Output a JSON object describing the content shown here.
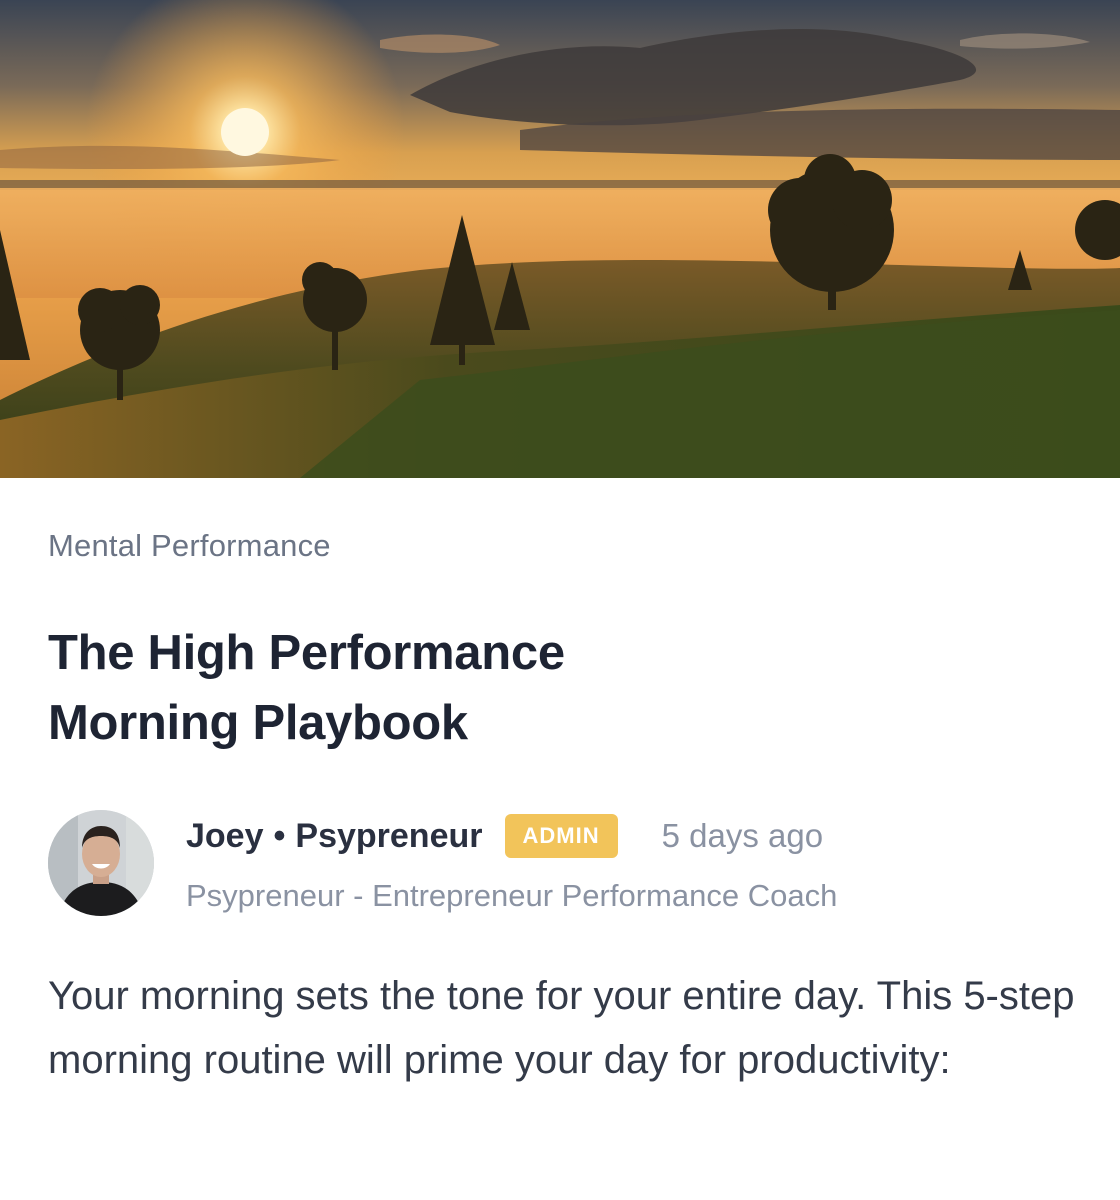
{
  "hero": {
    "image": "sunrise-over-misty-hills-photo"
  },
  "post": {
    "category": "Mental Performance",
    "title_line1": "The High Performance",
    "title_line2": "Morning Playbook",
    "author": {
      "name": "Joey",
      "separator": "•",
      "brand": "Psypreneur",
      "badge": "ADMIN",
      "timestamp": "5 days ago",
      "subtitle": "Psypreneur - Entrepreneur Performance Coach"
    },
    "body": "Your morning sets the tone for your entire day. This 5-step morning routine will prime your day for productivity:"
  },
  "colors": {
    "badge": "#f2c45a",
    "title": "#1e2433",
    "muted": "#8a92a2"
  }
}
